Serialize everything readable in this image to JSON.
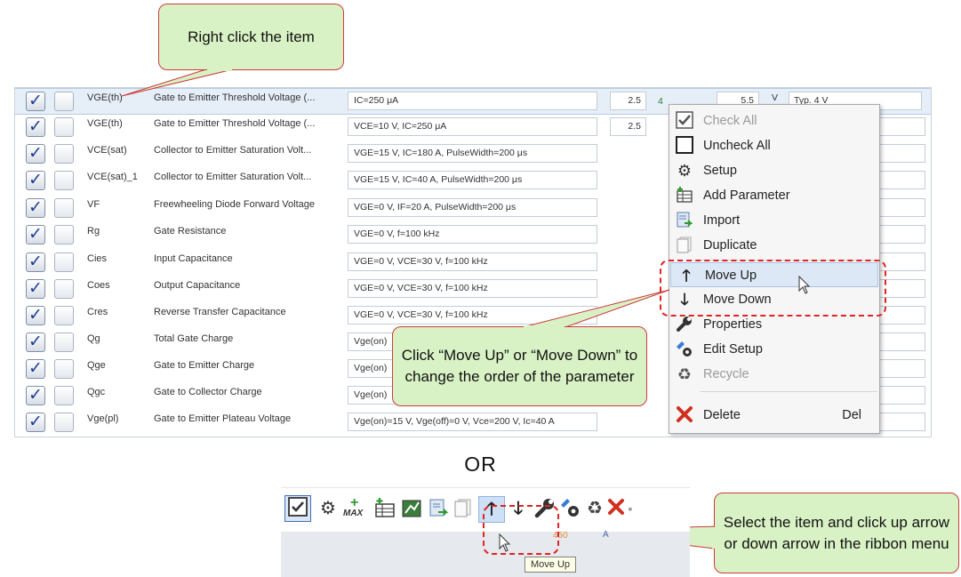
{
  "callouts": {
    "top": "Right click the item",
    "middle": "Click “Move Up” or “Move Down” to change the order of the parameter",
    "bottom": "Select the item and click up arrow or down arrow in the ribbon menu"
  },
  "or_label": "OR",
  "first_row": {
    "typ_value": "4",
    "max_value": "5.5",
    "unit": "V",
    "comment": "Typ. 4 V"
  },
  "rows": [
    {
      "symbol": "VGE(th)",
      "description": "Gate to Emitter Threshold Voltage (...",
      "condition": "IC=250 μA",
      "min": "2.5"
    },
    {
      "symbol": "VGE(th)",
      "description": "Gate to Emitter Threshold Voltage (...",
      "condition": "VCE=10 V, IC=250 μA",
      "min": "2.5"
    },
    {
      "symbol": "VCE(sat)",
      "description": "Collector to Emitter Saturation Volt...",
      "condition": "VGE=15 V, IC=180 A, PulseWidth=200 μs"
    },
    {
      "symbol": "VCE(sat)_1",
      "description": "Collector to Emitter Saturation Volt...",
      "condition": "VGE=15 V, IC=40 A, PulseWidth=200 μs"
    },
    {
      "symbol": "VF",
      "description": "Freewheeling Diode Forward Voltage",
      "condition": "VGE=0 V, IF=20 A, PulseWidth=200 μs"
    },
    {
      "symbol": "Rg",
      "description": "Gate Resistance",
      "condition": "VGE=0 V, f=100 kHz"
    },
    {
      "symbol": "Cies",
      "description": "Input Capacitance",
      "condition": "VGE=0 V, VCE=30 V, f=100 kHz"
    },
    {
      "symbol": "Coes",
      "description": "Output Capacitance",
      "condition": "VGE=0 V, VCE=30 V, f=100 kHz"
    },
    {
      "symbol": "Cres",
      "description": "Reverse Transfer Capacitance",
      "condition": "VGE=0 V, VCE=30 V, f=100 kHz"
    },
    {
      "symbol": "Qg",
      "description": "Total Gate Charge",
      "condition": "Vge(on)"
    },
    {
      "symbol": "Qge",
      "description": "Gate to Emitter Charge",
      "condition": "Vge(on)"
    },
    {
      "symbol": "Qgc",
      "description": "Gate to Collector Charge",
      "condition": "Vge(on)"
    },
    {
      "symbol": "Vge(pl)",
      "description": "Gate to Emitter Plateau Voltage",
      "condition": "Vge(on)=15 V, Vge(off)=0 V, Vce=200 V, Ic=40 A"
    }
  ],
  "context_menu": {
    "check_all": "Check All",
    "uncheck_all": "Uncheck All",
    "setup": "Setup",
    "add_parameter": "Add Parameter",
    "import": "Import",
    "duplicate": "Duplicate",
    "move_up": "Move Up",
    "move_down": "Move Down",
    "properties": "Properties",
    "edit_setup": "Edit Setup",
    "recycle": "Recycle",
    "delete": "Delete",
    "delete_shortcut": "Del"
  },
  "ribbon": {
    "max_label": "MAX",
    "partial_value": "450",
    "partial_letter": "A",
    "tooltip": "Move Up"
  },
  "colors": {
    "callout_fill": "#d9f2c5",
    "callout_border": "#cc3b3b",
    "dash": "#e02424",
    "checkmark": "#1d3f8f"
  }
}
